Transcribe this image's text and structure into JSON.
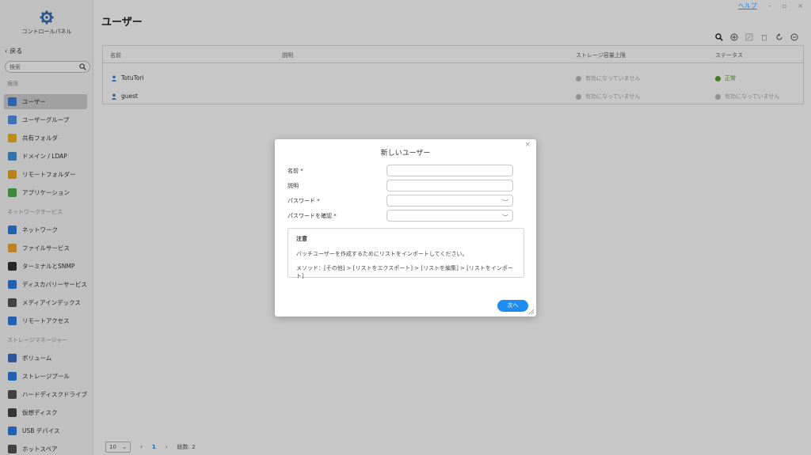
{
  "window": {
    "help_label": "ヘルプ",
    "minimize": "–",
    "restore": "▫",
    "close": "×"
  },
  "sidebar": {
    "title": "コントロールパネル",
    "back_label": "戻る",
    "search_placeholder": "検索",
    "sections": [
      {
        "title": "権限",
        "items": [
          {
            "label": "ユーザー",
            "color": "#3d7fd6",
            "active": true
          },
          {
            "label": "ユーザーグループ",
            "color": "#5a8fe0"
          },
          {
            "label": "共有フォルダ",
            "color": "#f0b429"
          },
          {
            "label": "ドメイン / LDAP",
            "color": "#4a90d9"
          },
          {
            "label": "リモートフォルダー",
            "color": "#e8a820"
          },
          {
            "label": "アプリケーション",
            "color": "#4caf50"
          }
        ]
      },
      {
        "title": "ネットワークサービス",
        "items": [
          {
            "label": "ネットワーク",
            "color": "#2d7be0"
          },
          {
            "label": "ファイルサービス",
            "color": "#f0a830"
          },
          {
            "label": "ターミナルとSNMP",
            "color": "#333333"
          },
          {
            "label": "ディスカバリーサービス",
            "color": "#2d7be0"
          },
          {
            "label": "メディアインデックス",
            "color": "#555555"
          },
          {
            "label": "リモートアクセス",
            "color": "#2d7be0"
          }
        ]
      },
      {
        "title": "ストレージマネージャー",
        "items": [
          {
            "label": "ボリューム",
            "color": "#3b6fc4"
          },
          {
            "label": "ストレージプール",
            "color": "#2d7be0"
          },
          {
            "label": "ハードディスクドライブ",
            "color": "#555555"
          },
          {
            "label": "仮想ディスク",
            "color": "#444444"
          },
          {
            "label": "USB デバイス",
            "color": "#2d7be0"
          },
          {
            "label": "ホットスペア",
            "color": "#555555"
          }
        ]
      }
    ]
  },
  "main": {
    "title": "ユーザー",
    "table": {
      "headers": [
        "名前",
        "説明",
        "ストレージ容量上限",
        "ステータス"
      ],
      "rows": [
        {
          "name": "TotuTori",
          "desc": "",
          "quota": "有効になっていません",
          "status": "正常",
          "status_ok": true
        },
        {
          "name": "guest",
          "desc": "",
          "quota": "有効になっていません",
          "status": "有効になっていません",
          "status_ok": false
        }
      ]
    },
    "pager": {
      "page_size": "10",
      "current_page": "1",
      "total": "総数: 2"
    }
  },
  "modal": {
    "title": "新しいユーザー",
    "fields": [
      {
        "label": "名前 *",
        "value": ""
      },
      {
        "label": "説明",
        "value": ""
      },
      {
        "label": "パスワード *",
        "value": ""
      },
      {
        "label": "パスワードを確認 *",
        "value": ""
      }
    ],
    "note_title": "注意",
    "note_line1": "バッチユーザーを作成するためにリストをインポートしてください。",
    "note_line2": "メソッド：[その他] > [リストをエクスポート] > [リストを編集] > [リストをインポート]",
    "next_label": "次へ"
  },
  "colors": {
    "accent": "#1e8cf0",
    "ok": "#5a9e2a"
  }
}
